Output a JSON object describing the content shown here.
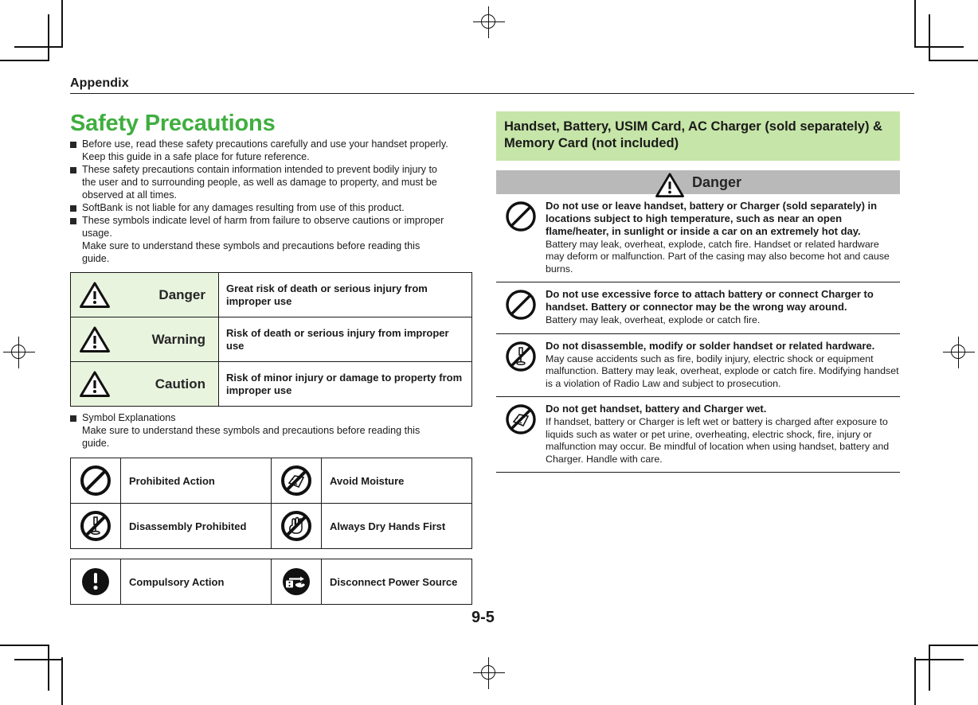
{
  "page": {
    "running_head": "Appendix",
    "page_number": "9-5",
    "colors": {
      "title_green": "#3fae3f",
      "banner_green": "#c6e5a8",
      "label_cell_green": "#e9f4df",
      "danger_band_gray": "#b9b9b9",
      "text": "#1a1a1a"
    }
  },
  "left": {
    "title": "Safety Precautions",
    "intro_bullets": [
      {
        "lines": [
          "Before use, read these safety precautions carefully and use your handset properly.",
          "Keep this guide in a safe place for future reference."
        ]
      },
      {
        "lines": [
          "These safety precautions contain information intended to prevent bodily injury to",
          "the user and to surrounding people, as well as damage to property, and must be",
          "observed at all times."
        ]
      },
      {
        "lines": [
          "SoftBank is not liable for any damages resulting from use of this product."
        ]
      },
      {
        "lines": [
          "These symbols indicate level of harm from failure to observe cautions or improper",
          "usage.",
          "Make sure to understand these symbols and precautions before reading this",
          "guide."
        ]
      }
    ],
    "level_table": {
      "rows": [
        {
          "icon": "warning-triangle-icon",
          "label": "Danger",
          "description": "Great risk of death or serious injury from improper use"
        },
        {
          "icon": "warning-triangle-icon",
          "label": "Warning",
          "description": "Risk of death or serious injury from improper use"
        },
        {
          "icon": "warning-triangle-icon",
          "label": "Caution",
          "description": "Risk of minor injury or damage to property from improper use"
        }
      ]
    },
    "symbol_heading": {
      "bullet": "Symbol Explanations",
      "lines": [
        "Make sure to understand these symbols and precautions before reading this",
        "guide."
      ]
    },
    "symbol_table_1": {
      "rows": [
        {
          "left_icon": "prohibited-circle-icon",
          "left_label": "Prohibited Action",
          "right_icon": "avoid-moisture-icon",
          "right_label": "Avoid Moisture"
        },
        {
          "left_icon": "disassembly-prohibited-icon",
          "left_label": "Disassembly Prohibited",
          "right_icon": "wet-hands-prohibited-icon",
          "right_label": "Always Dry Hands First"
        }
      ]
    },
    "symbol_table_2": {
      "rows": [
        {
          "left_icon": "compulsory-action-icon",
          "left_label": "Compulsory Action",
          "right_icon": "unplug-power-icon",
          "right_label": "Disconnect Power Source"
        }
      ]
    }
  },
  "right": {
    "section_banner": "Handset, Battery, USIM Card, AC Charger (sold separately) & Memory Card (not included)",
    "danger_band": {
      "icon": "warning-triangle-icon",
      "label": "Danger"
    },
    "warnings": [
      {
        "icon": "prohibited-circle-icon",
        "title": "Do not use or leave handset, battery or Charger (sold separately) in locations subject to high temperature, such as near an open flame/heater, in sunlight or inside a car on an extremely hot day.",
        "detail": "Battery may leak, overheat, explode, catch fire. Handset or related hardware may deform or malfunction. Part of the casing may also become hot and cause burns."
      },
      {
        "icon": "prohibited-circle-icon",
        "title": "Do not use excessive force to attach battery or connect Charger to handset. Battery or connector may be the wrong way around.",
        "detail": "Battery may leak, overheat, explode or catch fire."
      },
      {
        "icon": "disassembly-prohibited-icon",
        "title": "Do not disassemble, modify or solder handset or related hardware.",
        "detail": "May cause accidents such as fire, bodily injury, electric shock or equipment malfunction. Battery may leak, overheat, explode or catch fire. Modifying handset is a violation of Radio Law and subject to prosecution."
      },
      {
        "icon": "avoid-moisture-icon",
        "title": "Do not get handset, battery and Charger wet.",
        "detail": "If handset, battery or Charger is left wet or battery is charged after exposure to liquids such as water or pet urine, overheating, electric shock, fire, injury or malfunction may occur. Be mindful of location when using handset, battery and Charger. Handle with care."
      }
    ]
  }
}
